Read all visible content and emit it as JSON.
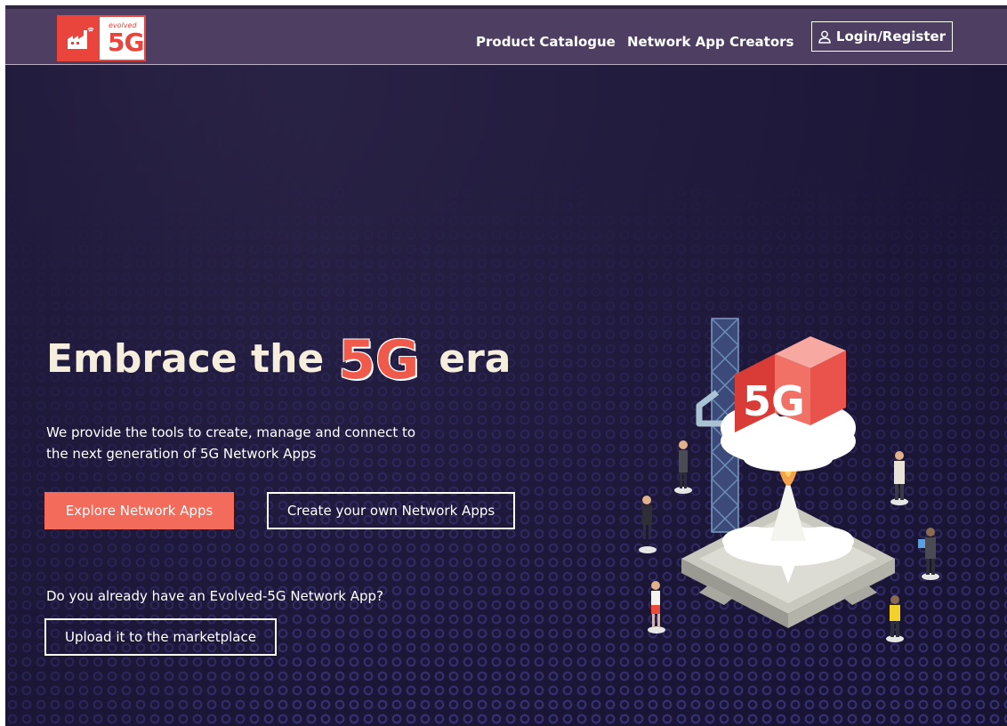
{
  "navbar": {
    "logo": {
      "small_text": "evolved",
      "big_text": "5G"
    },
    "links": [
      {
        "label": "Product Catalogue"
      },
      {
        "label": "Network App Creators"
      }
    ],
    "login_label": "Login/Register"
  },
  "hero": {
    "title_before": "Embrace the",
    "title_highlight": "5G",
    "title_after": "era",
    "description": "We provide the tools to create, manage and connect to the next generation of 5G Network Apps",
    "explore_button": "Explore Network Apps",
    "create_button": "Create your own Network Apps",
    "upload_question": "Do you already have an Evolved-5G Network App?",
    "upload_button": "Upload it to the marketplace"
  },
  "illustration": {
    "label": "5G",
    "icon": "rocket-launch-illustration"
  },
  "colors": {
    "navbar_bg": "#4e3e62",
    "background": "#1b1636",
    "accent": "#f36b5b",
    "title_text": "#f6eedc"
  }
}
